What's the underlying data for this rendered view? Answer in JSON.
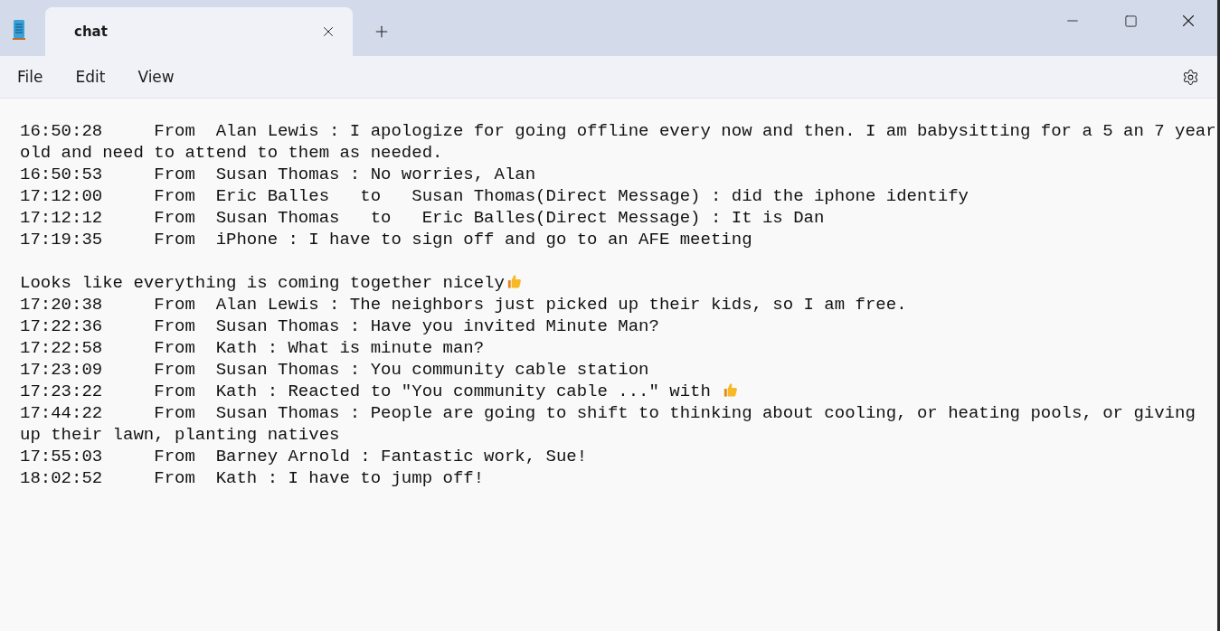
{
  "tabs": [
    {
      "title": "chat",
      "selected": true
    }
  ],
  "menu": [
    "File",
    "Edit",
    "View"
  ],
  "lines": [
    {
      "text": "16:50:28     From  Alan Lewis : I apologize for going offline every now and then. I am babysitting for a 5 an 7 year old and need to attend to them as needed.",
      "thumbs_up": false
    },
    {
      "text": "16:50:53     From  Susan Thomas : No worries, Alan",
      "thumbs_up": false
    },
    {
      "text": "17:12:00     From  Eric Balles   to   Susan Thomas(Direct Message) : did the iphone identify",
      "thumbs_up": false
    },
    {
      "text": "17:12:12     From  Susan Thomas   to   Eric Balles(Direct Message) : It is Dan",
      "thumbs_up": false
    },
    {
      "text": "17:19:35     From  iPhone : I have to sign off and go to an AFE meeting\n\nLooks like everything is coming together nicely",
      "thumbs_up": true
    },
    {
      "text": "17:20:38     From  Alan Lewis : The neighbors just picked up their kids, so I am free.",
      "thumbs_up": false
    },
    {
      "text": "17:22:36     From  Susan Thomas : Have you invited Minute Man?",
      "thumbs_up": false
    },
    {
      "text": "17:22:58     From  Kath : What is minute man?",
      "thumbs_up": false
    },
    {
      "text": "17:23:09     From  Susan Thomas : You community cable station",
      "thumbs_up": false
    },
    {
      "text": "17:23:22     From  Kath : Reacted to \"You community cable ...\" with ",
      "thumbs_up": true
    },
    {
      "text": "17:44:22     From  Susan Thomas : People are going to shift to thinking about cooling, or heating pools, or giving up their lawn, planting natives",
      "thumbs_up": false
    },
    {
      "text": "17:55:03     From  Barney Arnold : Fantastic work, Sue!",
      "thumbs_up": false
    },
    {
      "text": "18:02:52     From  Kath : I have to jump off!",
      "thumbs_up": false
    }
  ]
}
